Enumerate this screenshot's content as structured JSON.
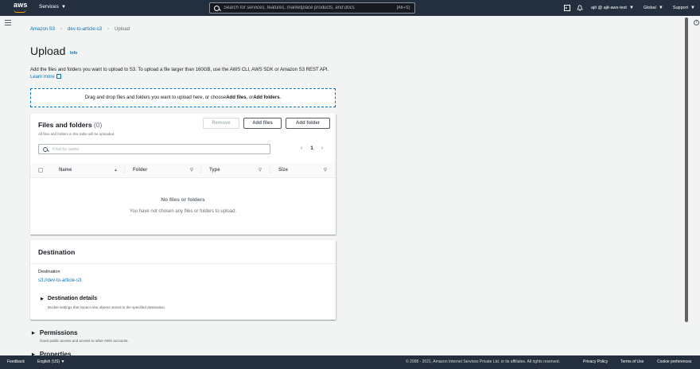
{
  "nav": {
    "logo_text": "aws",
    "services": "Services",
    "search_placeholder": "Search for services, features, marketplace products, and docs",
    "search_shortcut": "[Alt+S]",
    "user": "ajit @ ajit-aws-test",
    "region": "Global",
    "support": "Support"
  },
  "breadcrumb": [
    "Amazon S3",
    "dev-to-article-s3",
    "Upload"
  ],
  "page": {
    "title": "Upload",
    "info": "Info",
    "description": "Add the files and folders you want to upload to S3. To upload a file larger than 160GB, use the AWS CLI, AWS SDK or Amazon S3 REST API.",
    "learn_more": "Learn more"
  },
  "dropzone": {
    "prefix": "Drag and drop files and folders you want to upload here, or choose ",
    "add_files": "Add files",
    "mid": ", or ",
    "add_folders": "Add folders",
    "suffix": "."
  },
  "files": {
    "title": "Files and folders",
    "count": "(0)",
    "subtitle": "All files and folders in this table will be uploaded.",
    "remove": "Remove",
    "add_files": "Add files",
    "add_folder": "Add folder",
    "find_placeholder": "Find by name",
    "page": "1",
    "columns": [
      "Name",
      "Folder",
      "Type",
      "Size"
    ],
    "empty_title": "No files or folders",
    "empty_sub": "You have not chosen any files or folders to upload."
  },
  "destination": {
    "title": "Destination",
    "label": "Destination",
    "link": "s3://dev-to-article-s3",
    "details_title": "Destination details",
    "details_sub": "Bucket settings that impact new objects stored in the specified destination."
  },
  "permissions": {
    "title": "Permissions",
    "sub": "Grant public access and access to other AWS accounts."
  },
  "properties": {
    "title": "Properties"
  },
  "footer": {
    "feedback": "Feedback",
    "language": "English (US)",
    "copyright": "© 2008 - 2021, Amazon Internet Services Private Ltd. or its affiliates. All rights reserved.",
    "privacy": "Privacy Policy",
    "terms": "Terms of Use",
    "cookies": "Cookie preferences"
  }
}
